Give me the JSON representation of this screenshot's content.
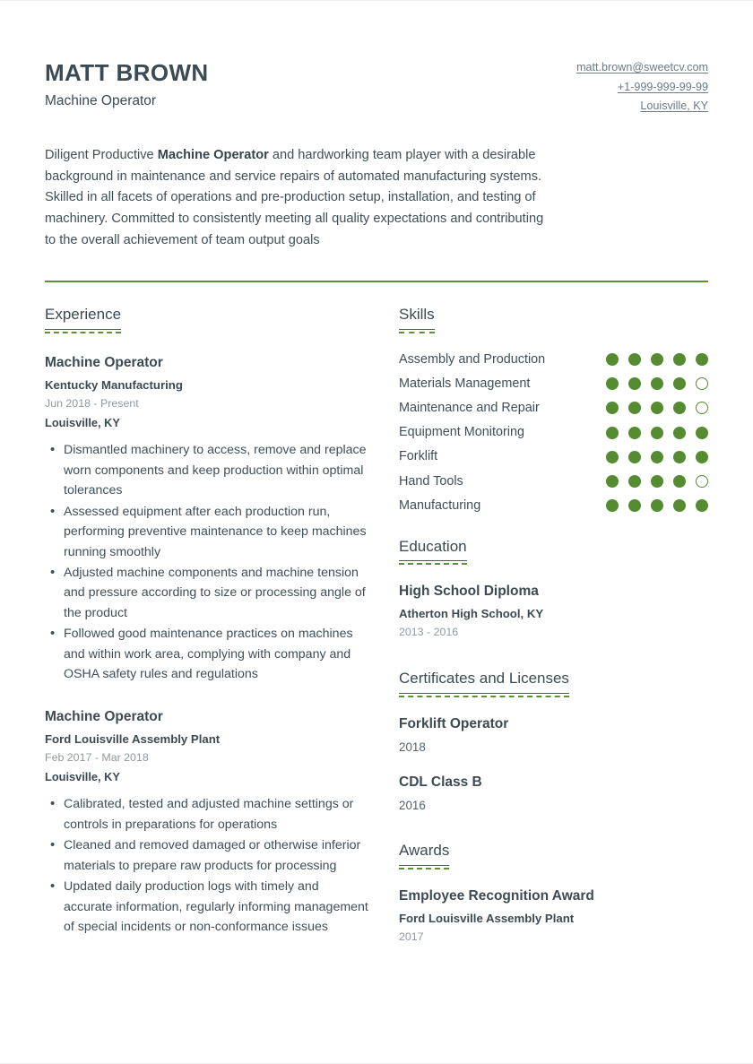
{
  "header": {
    "name": "MATT BROWN",
    "job_title": "Machine Operator",
    "contacts": [
      {
        "type": "email",
        "value": "matt.brown@sweetcv.com"
      },
      {
        "type": "phone",
        "value": "+1-999-999-99-99"
      },
      {
        "type": "location",
        "value": "Louisville, KY"
      }
    ]
  },
  "summary": {
    "before": "Diligent Productive ",
    "bold": "Machine Operator",
    "after": " and hardworking team player with a desirable background in maintenance and service repairs of automated manufacturing systems. Skilled in all facets of operations and pre-production setup, installation, and testing of machinery. Committed to consistently meeting all quality expectations and contributing to the overall achievement of team output goals"
  },
  "sections": {
    "experience": {
      "heading": "Experience",
      "entries": [
        {
          "title": "Machine Operator",
          "org": "Kentucky Manufacturing",
          "date": "Jun 2018 - Present",
          "location": "Louisville, KY",
          "bullets": [
            "Dismantled machinery to access, remove and replace worn components and keep production within optimal tolerances",
            "Assessed equipment after each production run, performing preventive maintenance to keep machines running smoothly",
            "Adjusted machine components and machine tension and pressure according to size or processing angle of the product",
            "Followed good maintenance practices on machines and within work area, complying with company and OSHA safety rules and regulations"
          ]
        },
        {
          "title": "Machine Operator",
          "org": "Ford Louisville Assembly Plant",
          "date": "Feb 2017 - Mar 2018",
          "location": "Louisville, KY",
          "bullets": [
            "Calibrated, tested and adjusted machine settings or controls in preparations for operations",
            "Cleaned and removed damaged or otherwise inferior materials to prepare raw products for processing",
            "Updated daily production logs with timely and accurate information, regularly informing management of special incidents or non-conformance issues"
          ]
        }
      ]
    },
    "skills": {
      "heading": "Skills",
      "max_rating": 5,
      "items": [
        {
          "name": "Assembly and Production",
          "rating": 5
        },
        {
          "name": "Materials Management",
          "rating": 4
        },
        {
          "name": "Maintenance and Repair",
          "rating": 4
        },
        {
          "name": "Equipment Monitoring",
          "rating": 5
        },
        {
          "name": "Forklift",
          "rating": 5
        },
        {
          "name": "Hand Tools",
          "rating": 4
        },
        {
          "name": "Manufacturing",
          "rating": 5
        }
      ]
    },
    "education": {
      "heading": "Education",
      "entries": [
        {
          "title": "High School Diploma",
          "org": "Atherton High School, KY",
          "date": "2013 - 2016"
        }
      ]
    },
    "certificates": {
      "heading": "Certificates and Licenses",
      "entries": [
        {
          "title": "Forklift Operator",
          "year": "2018"
        },
        {
          "title": "CDL Class B",
          "year": "2016"
        }
      ]
    },
    "awards": {
      "heading": "Awards",
      "entries": [
        {
          "title": "Employee Recognition Award",
          "org": "Ford Louisville Assembly Plant",
          "date": "2017"
        }
      ]
    }
  },
  "colors": {
    "accent_green": "#5e9134",
    "dot_green": "#558b31",
    "heading_dark": "#3b4a53",
    "body_text": "#3f4f59",
    "muted_text": "#8d9aa2",
    "link_text": "#6a7b86"
  }
}
